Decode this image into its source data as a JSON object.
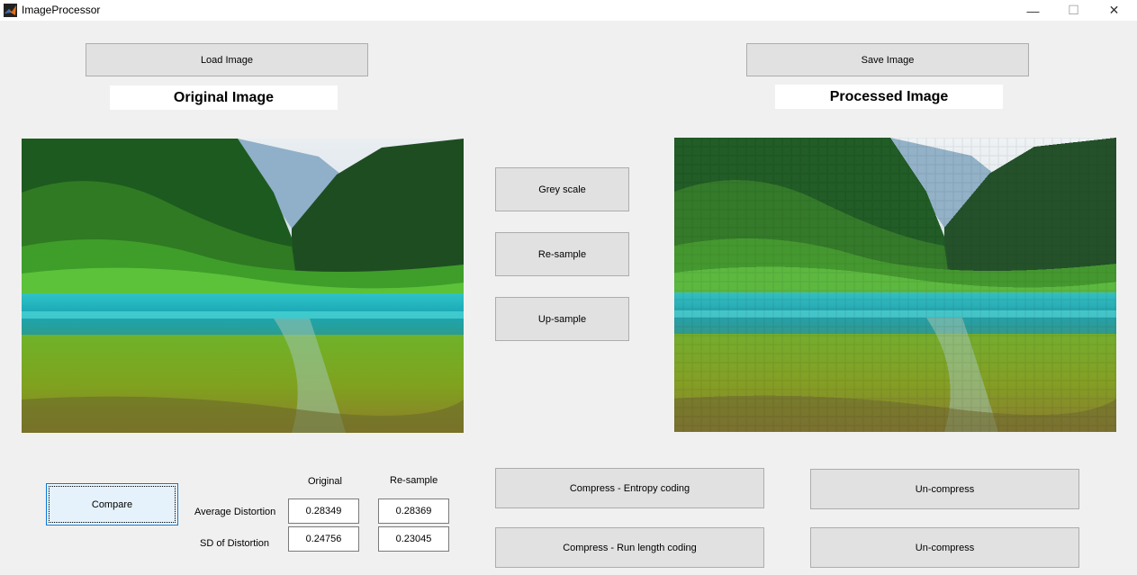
{
  "window": {
    "title": "ImageProcessor",
    "minimize": "—",
    "maximize": "☐",
    "close": "✕"
  },
  "buttons": {
    "load_image": "Load Image",
    "save_image": "Save Image",
    "grey_scale": "Grey scale",
    "re_sample": "Re-sample",
    "up_sample": "Up-sample",
    "compare": "Compare",
    "compress_entropy": "Compress - Entropy coding",
    "compress_rle": "Compress - Run length coding",
    "uncompress_1": "Un-compress",
    "uncompress_2": "Un-compress"
  },
  "headings": {
    "original": "Original Image",
    "processed": "Processed Image"
  },
  "stats": {
    "col_original": "Original",
    "col_resample": "Re-sample",
    "row_avg": "Average Distortion",
    "row_sd": "SD of Distortion",
    "avg_original": "0.28349",
    "avg_resample": "0.28369",
    "sd_original": "0.24756",
    "sd_resample": "0.23045"
  }
}
